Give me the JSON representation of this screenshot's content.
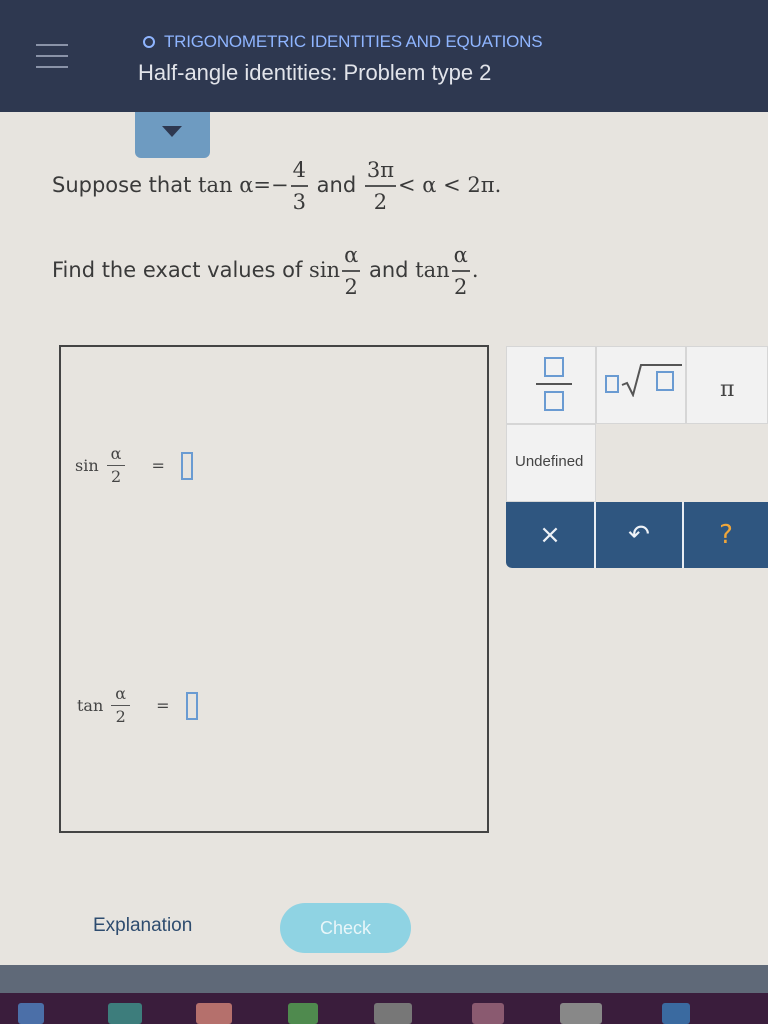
{
  "header": {
    "topic": "TRIGONOMETRIC IDENTITIES AND EQUATIONS",
    "subtitle": "Half-angle identities: Problem type 2"
  },
  "problem": {
    "line1_prefix": "Suppose that",
    "tan_alpha": "tan α",
    "equals": "=",
    "minus": "−",
    "frac1_num": "4",
    "frac1_den": "3",
    "and1": "and",
    "frac2_num": "3π",
    "frac2_den": "2",
    "ineq": "< α < 2π.",
    "line2_prefix": "Find the exact values of",
    "sin": "sin",
    "and2": "and",
    "tan": "tan",
    "half_num": "α",
    "half_den": "2",
    "period": "."
  },
  "answers": {
    "sin_label": "sin",
    "tan_label": "tan",
    "alpha": "α",
    "two": "2",
    "equals": "="
  },
  "keypad": {
    "pi": "π",
    "undefined": "Undefined",
    "clear": "×",
    "undo": "↶",
    "help": "?"
  },
  "footer": {
    "explanation": "Explanation",
    "check": "Check"
  },
  "colors": {
    "header_bg": "#2e3850",
    "topic": "#8fb5ff",
    "keypad_bar": "#2f5680",
    "check_button": "#8fd3e3",
    "input_border": "#6a9bd2"
  }
}
